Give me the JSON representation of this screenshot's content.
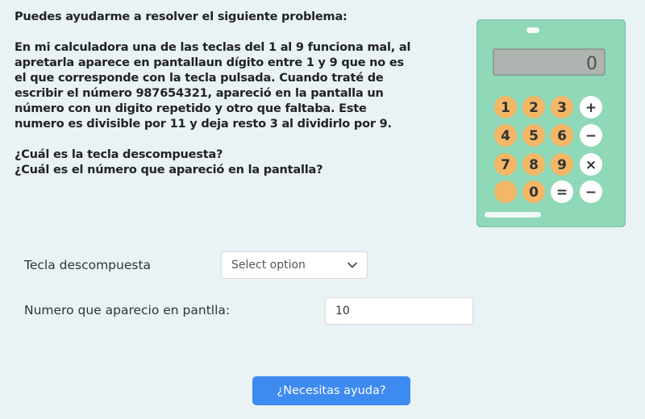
{
  "problem": {
    "title": "Puedes ayudarme a resolver el siguiente problema:",
    "lines": [
      "En mi calculadora una de las teclas del 1 al 9 funciona mal, al",
      "apretarla aparece en pantallaun dígito entre 1 y 9 que no es",
      "el que corresponde con la tecla pulsada. Cuando traté de",
      "escribir el número 987654321, apareció en la pantalla un",
      "número con un digito repetido y otro que faltaba. Este",
      "numero es divisible por 11 y  deja resto 3 al dividirlo por 9."
    ],
    "questions": [
      "¿Cuál es la tecla descompuesta?",
      "¿Cuál es el número que apareció en la pantalla?"
    ]
  },
  "calculator": {
    "display_value": "0",
    "keys": [
      "1",
      "2",
      "3",
      "+",
      "4",
      "5",
      "6",
      "−",
      "7",
      "8",
      "9",
      "×",
      "",
      "0",
      "=",
      "−"
    ],
    "colors": {
      "body": "#8fd8b8",
      "display": "#aeb5b1",
      "number_key": "#f4b766",
      "operator_key": "#ffffff"
    }
  },
  "form": {
    "key_label": "Tecla descompuesta",
    "key_select_value": "Select option",
    "number_label": "Numero que aparecio en pantlla:",
    "number_value": "10"
  },
  "help_button": {
    "label": "¿Necesitas ayuda?",
    "color": "#3d8af0"
  }
}
